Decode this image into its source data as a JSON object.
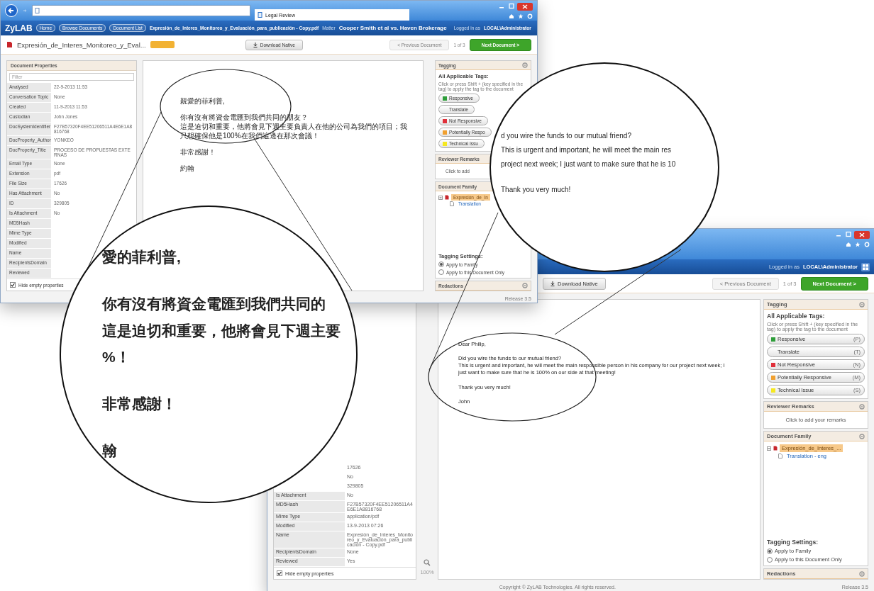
{
  "windows": [
    {
      "kind": "browser",
      "tab": "Legal Review",
      "app_bar": {
        "logo": "ZyLAB",
        "breadcrumbs": [
          "Home",
          "Browse Documents",
          "Document List"
        ],
        "file": "Expresión_de_Interes_Monitoreo_y_Evaluación_para_publicación - Copy.pdf",
        "matter_label": "Matter",
        "matter": "Cooper Smith et al vs. Haven Brokerage",
        "user_label": "Logged in as",
        "user": "LOCAL\\Administrator"
      },
      "doc_bar": {
        "title": "Expresión_de_Interes_Monitoreo_y_Eval...",
        "download": "Download Native",
        "previous": "< Previous Document",
        "position": "1 of 3",
        "next": "Next Document >"
      },
      "properties": {
        "title": "Document Properties",
        "filter": "Filter",
        "rows": [
          {
            "label": "Analysed",
            "value": "22-9-2013 11:53"
          },
          {
            "label": "Conversation Topic",
            "value": "None"
          },
          {
            "label": "Created",
            "value": "11-9-2013 11:53"
          },
          {
            "label": "Custodian",
            "value": "John Jones"
          },
          {
            "label": "DocSystemIdentifier",
            "value": "F27B57320F4EE51206511A4E6E1A8816768"
          },
          {
            "label": "DocProperty_Author",
            "value": "YONKEO"
          },
          {
            "label": "DocProperty_Title",
            "value": "PROCESO DE PROPUESTAS EXTERNAS"
          },
          {
            "label": "Email Type",
            "value": "None"
          },
          {
            "label": "Extension",
            "value": "pdf"
          },
          {
            "label": "File Size",
            "value": "17626"
          },
          {
            "label": "Has Attachment",
            "value": "No"
          },
          {
            "label": "ID",
            "value": "329805"
          },
          {
            "label": "Is Attachment",
            "value": "No"
          },
          {
            "label": "MD5Hash"
          },
          {
            "label": "Mime Type"
          },
          {
            "label": "Modified"
          },
          {
            "label": "Name"
          },
          {
            "label": "RecipientsDomain"
          },
          {
            "label": "Reviewed"
          }
        ],
        "hide_empty": {
          "label": "Hide empty properties",
          "checked": true
        }
      },
      "document": {
        "paragraphs": [
          [
            "親愛的菲利普,"
          ],
          [
            "你有沒有將資金電匯到我們共同的朋友？",
            "這是迫切和重要，他將會見下週主要負責人在他的公司為我們的項目；我只想確保他是100%在我們這邊在那次會議！"
          ],
          [
            "非常感謝！"
          ],
          [
            "約翰"
          ]
        ]
      },
      "tagging": {
        "title": "Tagging",
        "heading": "All Applicable Tags:",
        "hint": "Click or press Shift + (key specified in the tag) to apply the tag to the document",
        "tags": [
          {
            "label": "Responsive",
            "color": "#2e9e3a"
          },
          {
            "label": "Translate"
          },
          {
            "label": "Not Responsive",
            "color": "#e0303a"
          },
          {
            "label": "Potentially Respo",
            "color": "#f0a030"
          },
          {
            "label": "Technical Issu",
            "color": "#f5e820"
          }
        ],
        "remarks": {
          "title": "Reviewer Remarks",
          "prompt": "Click to add"
        },
        "family": {
          "title": "Document Family",
          "items": [
            {
              "label": "Expresión_de_In",
              "selected": true,
              "children": [
                {
                  "label": "Translation",
                  "selected": false
                }
              ]
            }
          ]
        },
        "settings": {
          "title": "Tagging Settings:",
          "options": [
            {
              "label": "Apply to Family",
              "selected": true
            },
            {
              "label": "Apply to this Document Only",
              "selected": false
            }
          ]
        },
        "redactions": "Redactions"
      },
      "footer": {
        "release": "Release 3.5"
      }
    },
    {
      "kind": "plain",
      "app_bar": {
        "user_label": "Logged in as",
        "user": "LOCAL\\Administrator"
      },
      "doc_bar": {
        "download": "Download Native",
        "previous": "< Previous Document",
        "position": "1 of 3",
        "next": "Next Document >"
      },
      "properties": {
        "rows": [
          {
            "value": "17626"
          },
          {
            "value": "No"
          },
          {
            "value": "329805"
          },
          {
            "label": "Is Attachment",
            "value": "No"
          },
          {
            "label": "MD5Hash",
            "value": "F27B57320F4EE51206511A4E6E1A8816768"
          },
          {
            "label": "Mime Type",
            "value": "application/pdf"
          },
          {
            "label": "Modified",
            "value": "13-9-2013 07:26"
          },
          {
            "label": "Name",
            "value": "Expresión_de_Interes_Monitoreo_y_Evaluación_para_publicación - Copy.pdf"
          },
          {
            "label": "RecipientsDomain",
            "value": "None"
          },
          {
            "label": "Reviewed",
            "value": "Yes"
          }
        ],
        "hide_empty": {
          "label": "Hide empty properties",
          "checked": true
        }
      },
      "zoom": "100%",
      "document": {
        "paragraphs": [
          [
            "Dear Philip,"
          ],
          [
            "Did you wire the funds to our mutual friend?",
            "This is urgent and important, he will meet the main responsible person in his company for our project next week; I just want to make sure that he is 100% on our side at that meeting!"
          ],
          [
            "Thank you very much!"
          ],
          [
            "John"
          ]
        ]
      },
      "tagging": {
        "title": "Tagging",
        "heading": "All Applicable Tags:",
        "hint": "Click or press Shift + (key specified in the tag) to apply the tag to the document",
        "tags": [
          {
            "label": "Responsive",
            "key": "(P)",
            "color": "#2e9e3a"
          },
          {
            "label": "Translate",
            "key": "(T)"
          },
          {
            "label": "Not Responsive",
            "key": "(N)",
            "color": "#e0303a"
          },
          {
            "label": "Potentially Responsive",
            "key": "(M)",
            "color": "#f0a030"
          },
          {
            "label": "Technical Issue",
            "key": "(S)",
            "color": "#f5e820"
          }
        ],
        "remarks": {
          "title": "Reviewer Remarks",
          "prompt": "Click to add your remarks"
        },
        "family": {
          "title": "Document Family",
          "items": [
            {
              "label": "Expresión_de_Interes_...",
              "selected": true,
              "children": [
                {
                  "label": "Translation - eng",
                  "selected": false
                }
              ]
            }
          ]
        },
        "settings": {
          "title": "Tagging Settings:",
          "options": [
            {
              "label": "Apply to Family",
              "selected": true
            },
            {
              "label": "Apply to this Document Only",
              "selected": false
            }
          ]
        },
        "redactions": "Redactions"
      },
      "footer": {
        "copyright": "Copyright © ZyLAB Technologies. All rights reserved.",
        "release": "Release 3.5"
      }
    }
  ],
  "magnifiers": [
    {
      "kind": "cjk",
      "paragraphs": [
        [
          "愛的菲利普,"
        ],
        [
          "你有沒有將資金電匯到我們共同的",
          "這是迫切和重要，他將會見下週主要",
          "%！"
        ],
        [
          "非常感謝！"
        ],
        [
          "翰"
        ]
      ]
    },
    {
      "kind": "latin",
      "paragraphs": [
        [
          "d you wire the funds to our mutual friend?",
          "This is urgent and important, he will meet the main res",
          "project next week; I just want to make sure that he is 10"
        ],
        [
          "Thank you very much!"
        ]
      ]
    }
  ]
}
